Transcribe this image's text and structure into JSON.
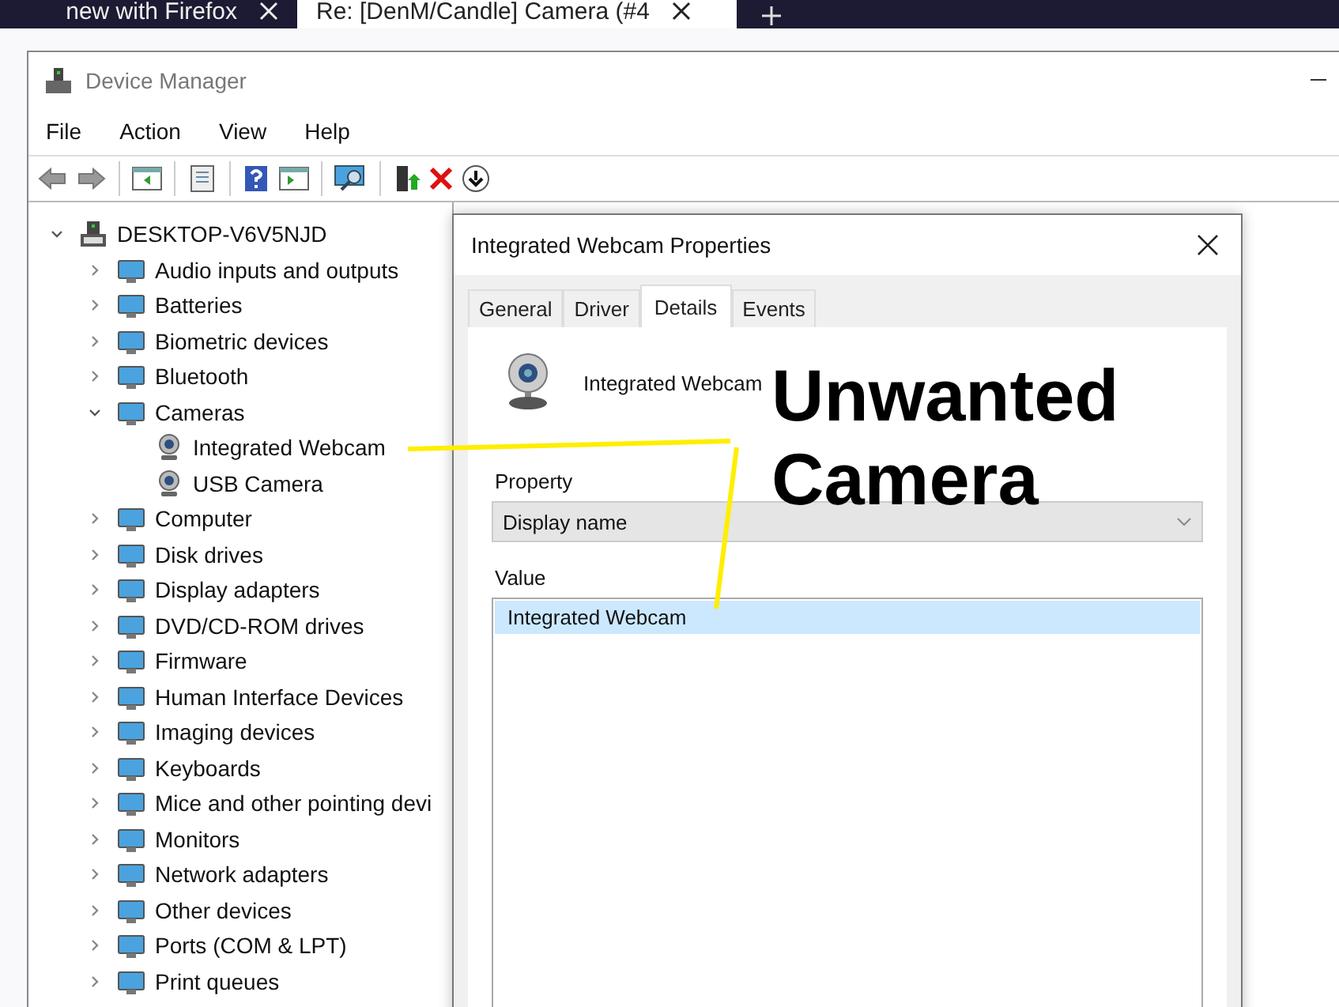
{
  "browser": {
    "tabs": [
      {
        "label": "new with Firefox",
        "selected": false
      },
      {
        "label": "Re: [DenM/Candle] Camera (#4",
        "selected": true
      }
    ]
  },
  "window": {
    "title": "Device Manager"
  },
  "menu": [
    "File",
    "Action",
    "View",
    "Help"
  ],
  "tree": {
    "label": "DESKTOP-V6V5NJD",
    "expanded": true,
    "children": [
      {
        "label": "Audio inputs and outputs",
        "expanded": false
      },
      {
        "label": "Batteries",
        "expanded": false
      },
      {
        "label": "Biometric devices",
        "expanded": false
      },
      {
        "label": "Bluetooth",
        "expanded": false
      },
      {
        "label": "Cameras",
        "expanded": true,
        "children": [
          {
            "label": "Integrated Webcam"
          },
          {
            "label": "USB Camera"
          }
        ]
      },
      {
        "label": "Computer",
        "expanded": false
      },
      {
        "label": "Disk drives",
        "expanded": false
      },
      {
        "label": "Display adapters",
        "expanded": false
      },
      {
        "label": "DVD/CD-ROM drives",
        "expanded": false
      },
      {
        "label": "Firmware",
        "expanded": false
      },
      {
        "label": "Human Interface Devices",
        "expanded": false
      },
      {
        "label": "Imaging devices",
        "expanded": false
      },
      {
        "label": "Keyboards",
        "expanded": false
      },
      {
        "label": "Mice and other pointing devi",
        "expanded": false
      },
      {
        "label": "Monitors",
        "expanded": false
      },
      {
        "label": "Network adapters",
        "expanded": false
      },
      {
        "label": "Other devices",
        "expanded": false
      },
      {
        "label": "Ports (COM & LPT)",
        "expanded": false
      },
      {
        "label": "Print queues",
        "expanded": false
      }
    ]
  },
  "dialog": {
    "title": "Integrated Webcam Properties",
    "tabs": [
      {
        "label": "General",
        "selected": false
      },
      {
        "label": "Driver",
        "selected": false
      },
      {
        "label": "Details",
        "selected": true
      },
      {
        "label": "Events",
        "selected": false
      }
    ],
    "device_name": "Integrated Webcam",
    "property_label": "Property",
    "property_value": "Display name",
    "value_label": "Value",
    "values": [
      {
        "text": "Integrated Webcam",
        "selected": true
      }
    ]
  },
  "annotation": {
    "text": "Unwanted Camera"
  }
}
